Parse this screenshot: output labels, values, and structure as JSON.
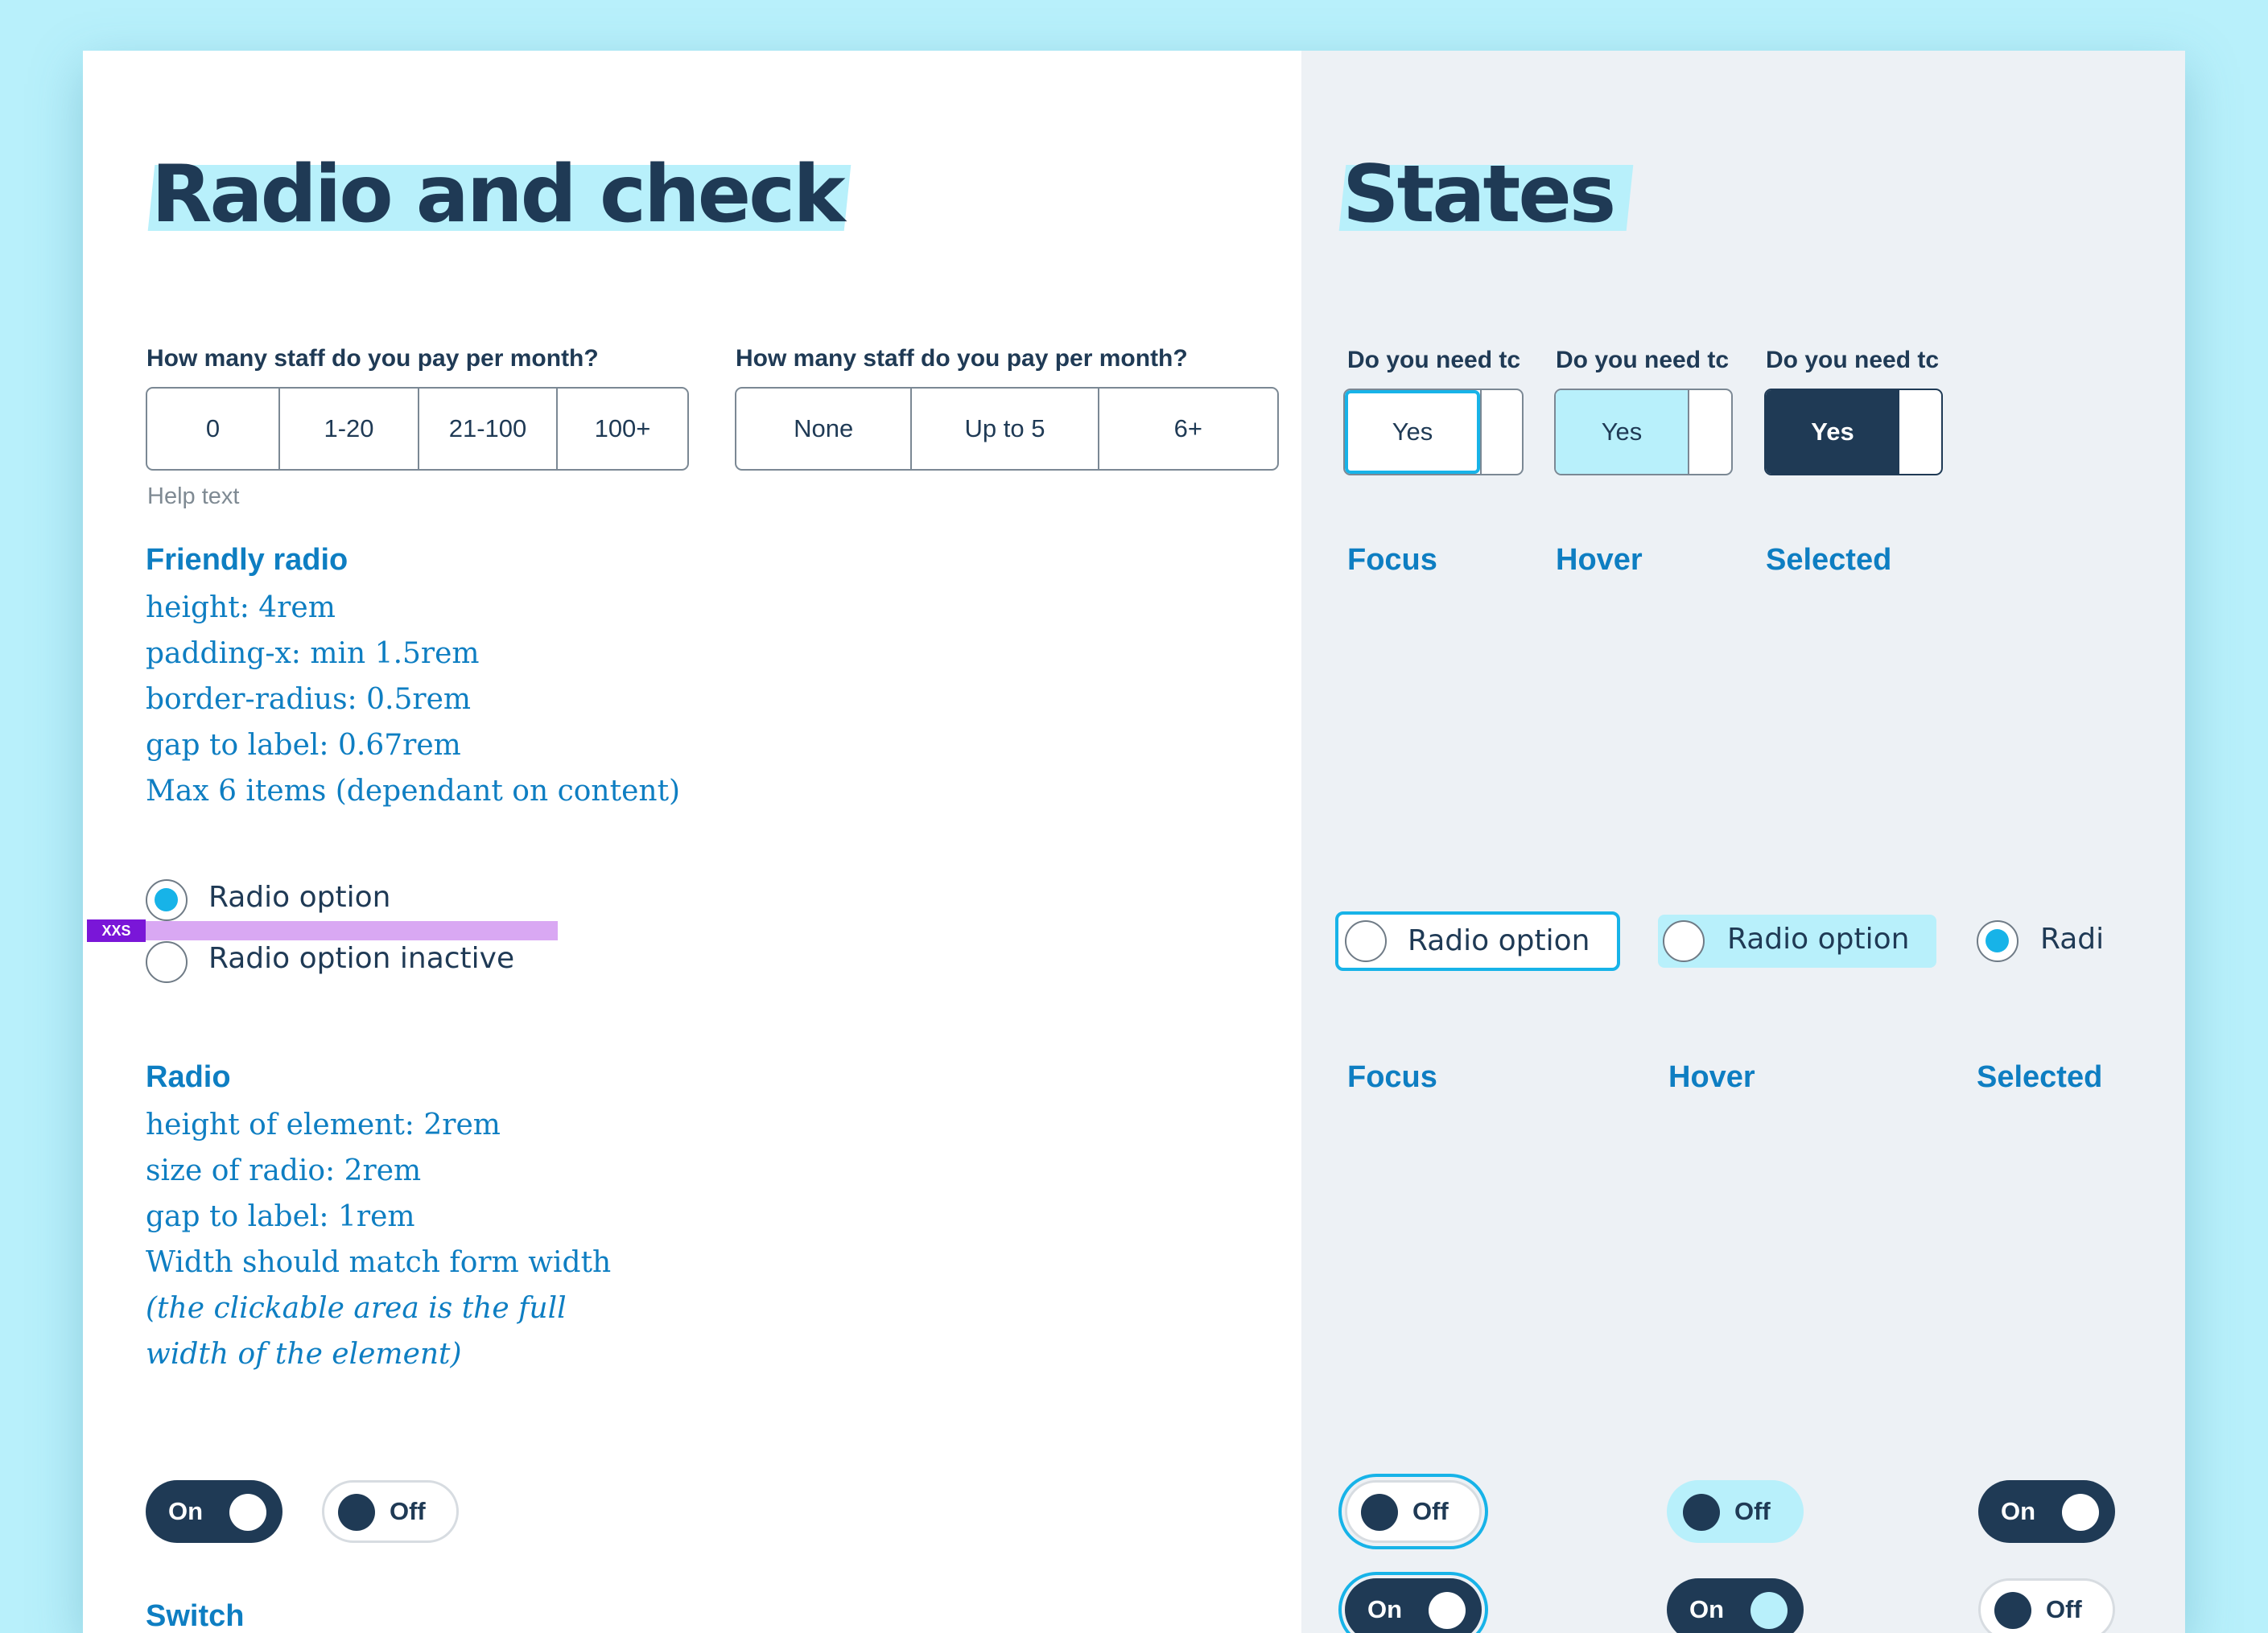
{
  "left": {
    "title": "Radio and check",
    "group1": {
      "question": "How many staff do you pay per month?",
      "options": [
        "0",
        "1-20",
        "21-100",
        "100+"
      ],
      "help": "Help text"
    },
    "group2": {
      "question": "How many staff do you pay per month?",
      "options": [
        "None",
        "Up to 5",
        "6+"
      ]
    },
    "friendly_spec": {
      "title": "Friendly radio",
      "lines": [
        "height: 4rem",
        "padding-x: min 1.5rem",
        "border-radius: 0.5rem",
        "gap to label: 0.67rem",
        "Max 6 items (dependant on content)"
      ]
    },
    "radios": {
      "active_label": "Radio option",
      "inactive_label": "Radio option inactive",
      "spacing_tag": "XXS"
    },
    "radio_spec": {
      "title": "Radio",
      "lines": [
        "height of element: 2rem",
        "size of radio: 2rem",
        "gap to label: 1rem",
        "Width should match form width",
        "(the clickable area is the full",
        "width of the element)"
      ]
    },
    "switches": {
      "on_label": "On",
      "off_label": "Off"
    },
    "switch_title": "Switch"
  },
  "right": {
    "title": "States",
    "seg_states": [
      {
        "question": "Do you need tc",
        "value": "Yes",
        "state": "Focus"
      },
      {
        "question": "Do you need tc",
        "value": "Yes",
        "state": "Hover"
      },
      {
        "question": "Do you need tc",
        "value": "Yes",
        "state": "Selected"
      }
    ],
    "radio_states": [
      {
        "label": "Radio option",
        "state": "Focus"
      },
      {
        "label": "Radio option",
        "state": "Hover"
      },
      {
        "label": "Radi",
        "state": "Selected"
      }
    ],
    "switch_states": {
      "row1": [
        "Off",
        "Off",
        "On"
      ],
      "row2": [
        "On",
        "On",
        "Off"
      ]
    }
  },
  "colors": {
    "navy": "#1f3a55",
    "accent_blue": "#0e7ec2",
    "highlight_cyan": "#b8f0fb",
    "radio_fill": "#17b3e8",
    "panel_grey": "#edf1f5",
    "spacing_purple": "#7a16d8"
  }
}
